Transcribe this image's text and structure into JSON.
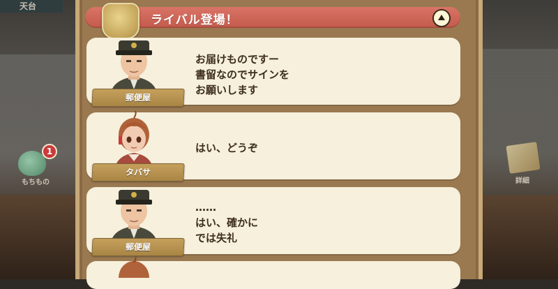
{
  "background": {
    "top_left_label": "天台",
    "left_item": {
      "label": "もちもの",
      "badge_count": "1",
      "icon": "flask-icon"
    },
    "right_item": {
      "label": "詳細",
      "icon": "book-icon"
    }
  },
  "header": {
    "title": "ライバル登場！",
    "collapse_icon": "chevron-up-icon"
  },
  "colors": {
    "title_bar": "#c45a4c",
    "card": "#f6f0dc",
    "text": "#3d2d1c",
    "nameplate": "#b8924f"
  },
  "dialogue": [
    {
      "speaker": "郵便屋",
      "text": "お届けものですー\n書留なのでサインを\nお願いします"
    },
    {
      "speaker": "タバサ",
      "text": "はい、どうぞ"
    },
    {
      "speaker": "郵便屋",
      "text": "……\nはい、確かに\nでは失礼"
    }
  ]
}
